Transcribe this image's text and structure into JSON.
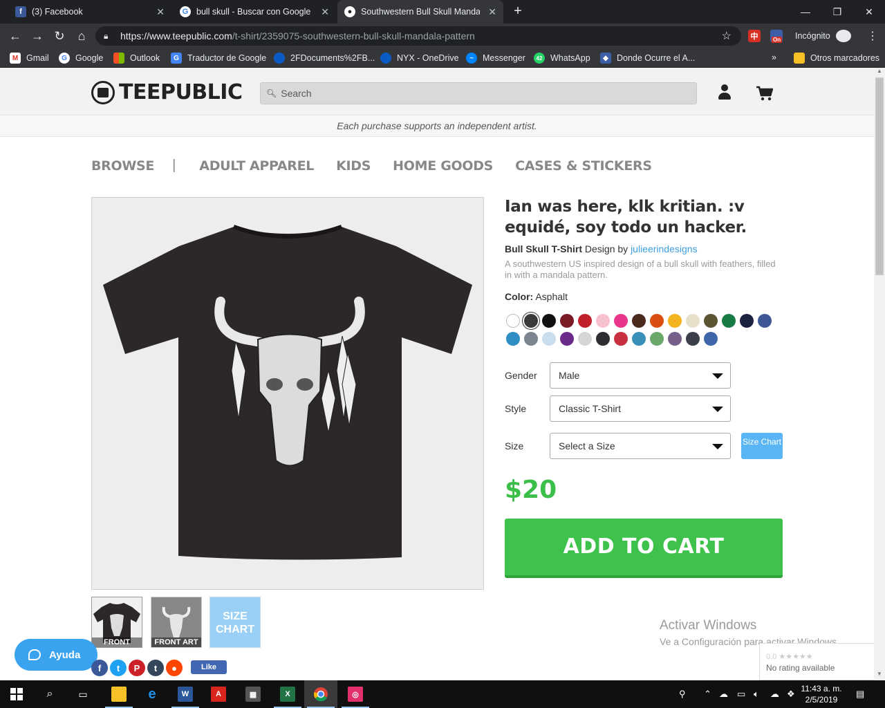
{
  "browser": {
    "tabs": [
      {
        "title": "(3) Facebook",
        "icon": "facebook-icon",
        "active": false
      },
      {
        "title": "bull skull - Buscar con Google",
        "icon": "google-icon",
        "active": false
      },
      {
        "title": "Southwestern Bull Skull Mandala",
        "icon": "teepublic-icon",
        "active": true
      }
    ],
    "url": {
      "host": "https://www.teepublic.com",
      "path": "/t-shirt/2359075-southwestern-bull-skull-mandala-pattern"
    },
    "incognito_label": "Incógnito",
    "ext_badge": "On",
    "bookmarks": [
      {
        "label": "Gmail",
        "icon": "gmail-icon"
      },
      {
        "label": "Google",
        "icon": "google-icon"
      },
      {
        "label": "Outlook",
        "icon": "outlook-icon"
      },
      {
        "label": "Traductor de Google",
        "icon": "translate-icon"
      },
      {
        "label": "2FDocuments%2FB...",
        "icon": "onedrive-icon"
      },
      {
        "label": "NYX - OneDrive",
        "icon": "onedrive-icon"
      },
      {
        "label": "Messenger",
        "icon": "messenger-icon"
      },
      {
        "label": "WhatsApp",
        "icon": "whatsapp-icon"
      },
      {
        "label": "Donde Ocurre el A...",
        "icon": "bookmark-icon"
      }
    ],
    "bookmarks_overflow": "»",
    "other_bookmarks": "Otros marcadores",
    "whatsapp_badge": "42"
  },
  "site": {
    "logo_text": "TEEPUBLIC",
    "search_placeholder": "Search",
    "support_text": "Each purchase supports an independent artist.",
    "nav": [
      "BROWSE",
      "|",
      "ADULT APPAREL",
      "KIDS",
      "HOME GOODS",
      "CASES & STICKERS"
    ]
  },
  "product": {
    "title": "Ian was here, klk kritian. :v equidé, soy todo un hacker.",
    "type": "Bull Skull T-Shirt",
    "design_by_text": "Design by",
    "designer": "julieerindesigns",
    "description": "A southwestern US inspired design of a bull skull with feathers, filled in with a mandala pattern.",
    "color_label": "Color:",
    "color_value": "Asphalt",
    "swatches": [
      "#ffffff",
      "#3b3b3d",
      "#111111",
      "#7a1a24",
      "#c0202a",
      "#f7c1cf",
      "#e8368a",
      "#4a2a1c",
      "#d94f12",
      "#f2b51d",
      "#e8e0c9",
      "#5a5530",
      "#1a7a45",
      "#1c2340",
      "#3e5596",
      "#2f8fc4",
      "#7a8590",
      "#c9dff0",
      "#6a2a8a",
      "#d6d6d6",
      "#2d2d33",
      "#c9303f",
      "#3a8fb8",
      "#6aa86a",
      "#76608a",
      "#3a3f4a",
      "#3e66a8"
    ],
    "selected_swatch": 1,
    "gender_label": "Gender",
    "gender_value": "Male",
    "style_label": "Style",
    "style_value": "Classic T-Shirt",
    "size_label": "Size",
    "size_value": "Select a Size",
    "size_chart_btn": "Size Chart",
    "price": "$20",
    "add_to_cart": "ADD TO CART",
    "thumbs": [
      {
        "caption": "FRONT"
      },
      {
        "caption": "FRONT ART"
      },
      {
        "caption": "SIZE CHART"
      }
    ]
  },
  "overlay": {
    "help_label": "Ayuda",
    "activate_title": "Activar Windows",
    "activate_sub": "Ve a Configuración para activar Windows.",
    "rating_score": "0.0 ★★★★★",
    "rating_text": "No rating available",
    "fb_like": "Like"
  },
  "taskbar": {
    "time": "11:43 a. m.",
    "date": "2/5/2019"
  }
}
